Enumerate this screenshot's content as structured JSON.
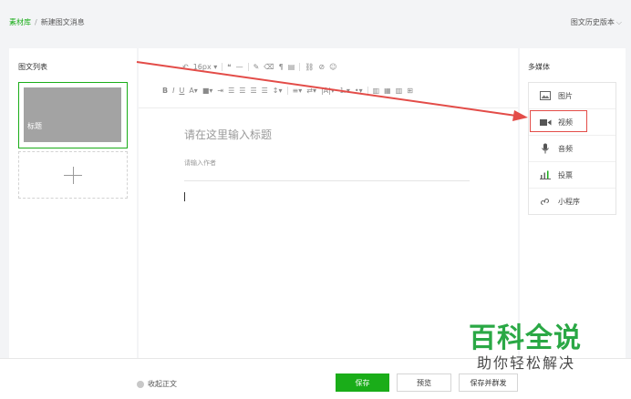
{
  "breadcrumb": {
    "root": "素材库",
    "separator": "/",
    "current": "新建图文消息"
  },
  "history": {
    "label": "图文历史版本"
  },
  "left_panel": {
    "title": "图文列表",
    "card_label": "标题"
  },
  "toolbar": {
    "font_size": "16px"
  },
  "editor": {
    "title_placeholder": "请在这里输入标题",
    "author_placeholder": "请输入作者"
  },
  "right_panel": {
    "title": "多媒体",
    "items": [
      {
        "label": "图片",
        "icon": "image-icon"
      },
      {
        "label": "视频",
        "icon": "video-icon"
      },
      {
        "label": "音频",
        "icon": "microphone-icon"
      },
      {
        "label": "投票",
        "icon": "bar-chart-icon"
      },
      {
        "label": "小程序",
        "icon": "mini-program-icon"
      }
    ]
  },
  "bottom_bar": {
    "collapse_label": "收起正文",
    "save_label": "保存",
    "preview_label": "预览",
    "publish_label": "保存并群发"
  },
  "watermark": {
    "line1": "百科全说",
    "line2": "助你轻松解决"
  },
  "colors": {
    "brand_green": "#1aad19",
    "highlight_red": "#e34c48"
  }
}
